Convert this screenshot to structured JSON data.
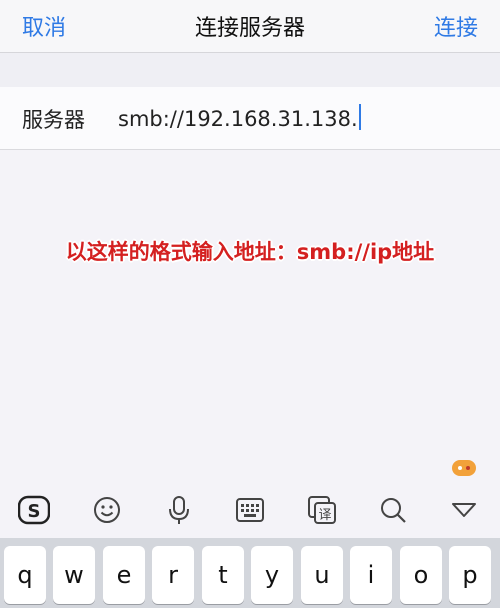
{
  "navbar": {
    "cancel_label": "取消",
    "title": "连接服务器",
    "connect_label": "连接"
  },
  "server_row": {
    "label": "服务器",
    "value": "smb://192.168.31.138."
  },
  "annotation": {
    "text": "以这样的格式输入地址：smb://ip地址",
    "color": "#d42020"
  },
  "toolbar": {
    "icons": [
      "sogou-logo-icon",
      "emoji-icon",
      "microphone-icon",
      "keyboard-icon",
      "translate-icon",
      "search-icon",
      "collapse-keyboard-icon"
    ],
    "translate_glyph": "译"
  },
  "keyboard": {
    "keys": [
      "q",
      "w",
      "e",
      "r",
      "t",
      "y",
      "u",
      "i",
      "o",
      "p"
    ]
  },
  "colors": {
    "accent": "#2f7ae5",
    "background": "#f4f3f8",
    "keyboard_bg": "#d3d6dc"
  }
}
